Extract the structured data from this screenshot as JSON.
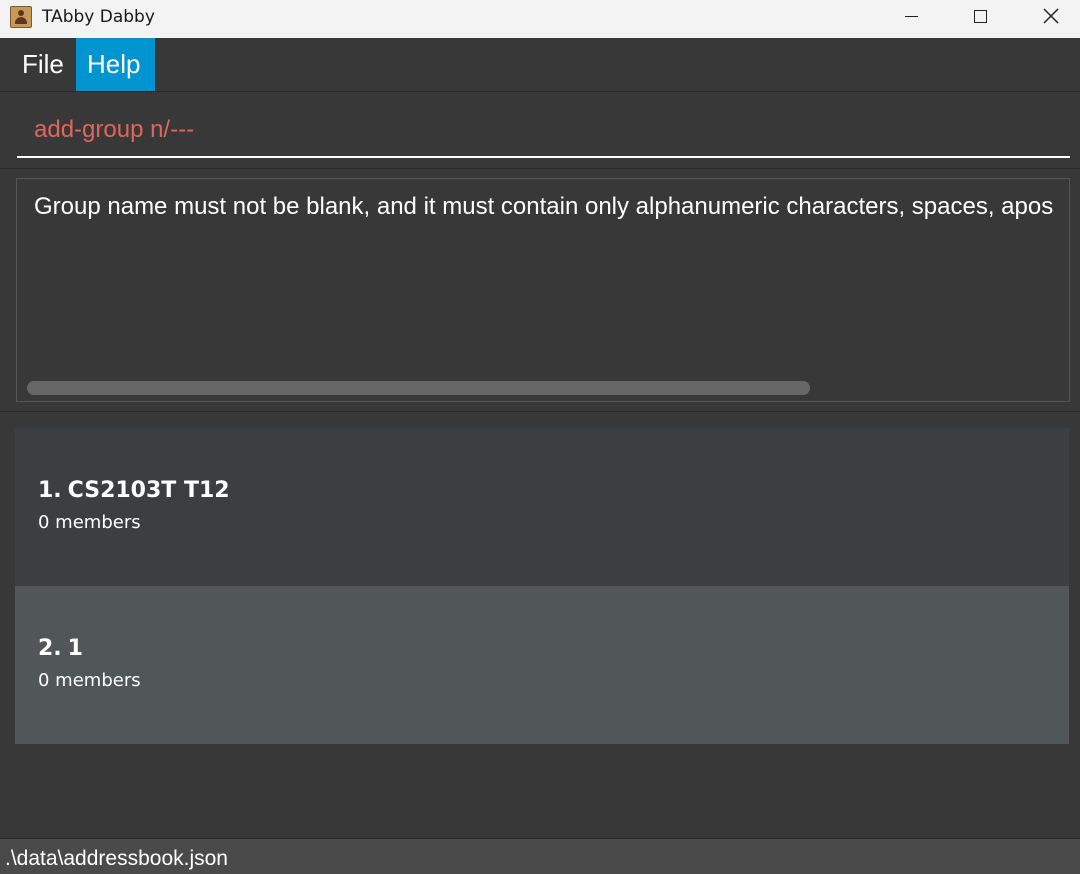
{
  "window": {
    "title": "TAbby Dabby",
    "icons": {
      "app": "addressbook-app-icon",
      "minimize": "minimize-icon",
      "maximize": "maximize-icon",
      "close": "close-icon"
    }
  },
  "menu": {
    "items": [
      {
        "label": "File",
        "active": false
      },
      {
        "label": "Help",
        "active": true
      }
    ],
    "active_color": "#0094d1"
  },
  "command": {
    "value": "add-group n/---",
    "error_color": "#e0665a"
  },
  "result": {
    "message": "Group name must not be blank, and it must contain only alphanumeric characters, spaces, apos"
  },
  "groups": [
    {
      "index": "1.",
      "name": "CS2103T T12",
      "members": "0 members"
    },
    {
      "index": "2.",
      "name": "1",
      "members": "0 members"
    }
  ],
  "status": {
    "file_path": ".\\data\\addressbook.json"
  }
}
